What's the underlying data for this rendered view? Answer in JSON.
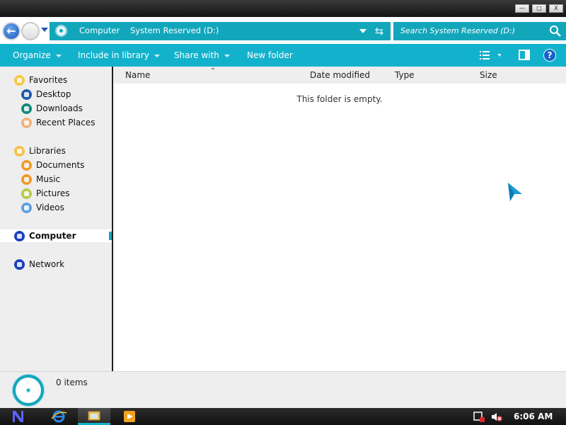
{
  "window": {
    "buttons": {
      "minimize": "—",
      "maximize": "□",
      "close": "X"
    }
  },
  "address_bar": {
    "back_glyph": "←",
    "breadcrumbs": [
      "Computer",
      "System Reserved (D:)"
    ],
    "refresh_glyph": "⇆",
    "search_placeholder": "Search System Reserved (D:)"
  },
  "command_bar": {
    "organize": "Organize",
    "include_in_library": "Include in library",
    "share_with": "Share with",
    "new_folder": "New folder",
    "help_glyph": "?"
  },
  "sidebar": {
    "favorites": {
      "label": "Favorites",
      "items": [
        {
          "label": "Desktop",
          "icon": "desktop-icon",
          "color": "#1d5aa8"
        },
        {
          "label": "Downloads",
          "icon": "downloads-icon",
          "color": "#128a78"
        },
        {
          "label": "Recent Places",
          "icon": "recent-places-icon",
          "color": "#f3b27a"
        }
      ]
    },
    "libraries": {
      "label": "Libraries",
      "items": [
        {
          "label": "Documents",
          "icon": "documents-icon",
          "color": "#f29a2e"
        },
        {
          "label": "Music",
          "icon": "music-icon",
          "color": "#f09a2a"
        },
        {
          "label": "Pictures",
          "icon": "pictures-icon",
          "color": "#b9c94a"
        },
        {
          "label": "Videos",
          "icon": "videos-icon",
          "color": "#5d9fe0"
        }
      ]
    },
    "computer": {
      "label": "Computer",
      "icon": "computer-icon",
      "color": "#1a3fbf"
    },
    "network": {
      "label": "Network",
      "icon": "network-icon",
      "color": "#1a3fbf"
    }
  },
  "columns": [
    "Name",
    "Date modified",
    "Type",
    "Size"
  ],
  "empty_message": "This folder is empty.",
  "status": {
    "items_count": "0 items"
  },
  "taskbar": {
    "clock": "6:06 AM"
  },
  "colors": {
    "accent": "#12a6bb",
    "command_bar": "#12b2cc",
    "sidebar_bg": "#eeeeee"
  }
}
